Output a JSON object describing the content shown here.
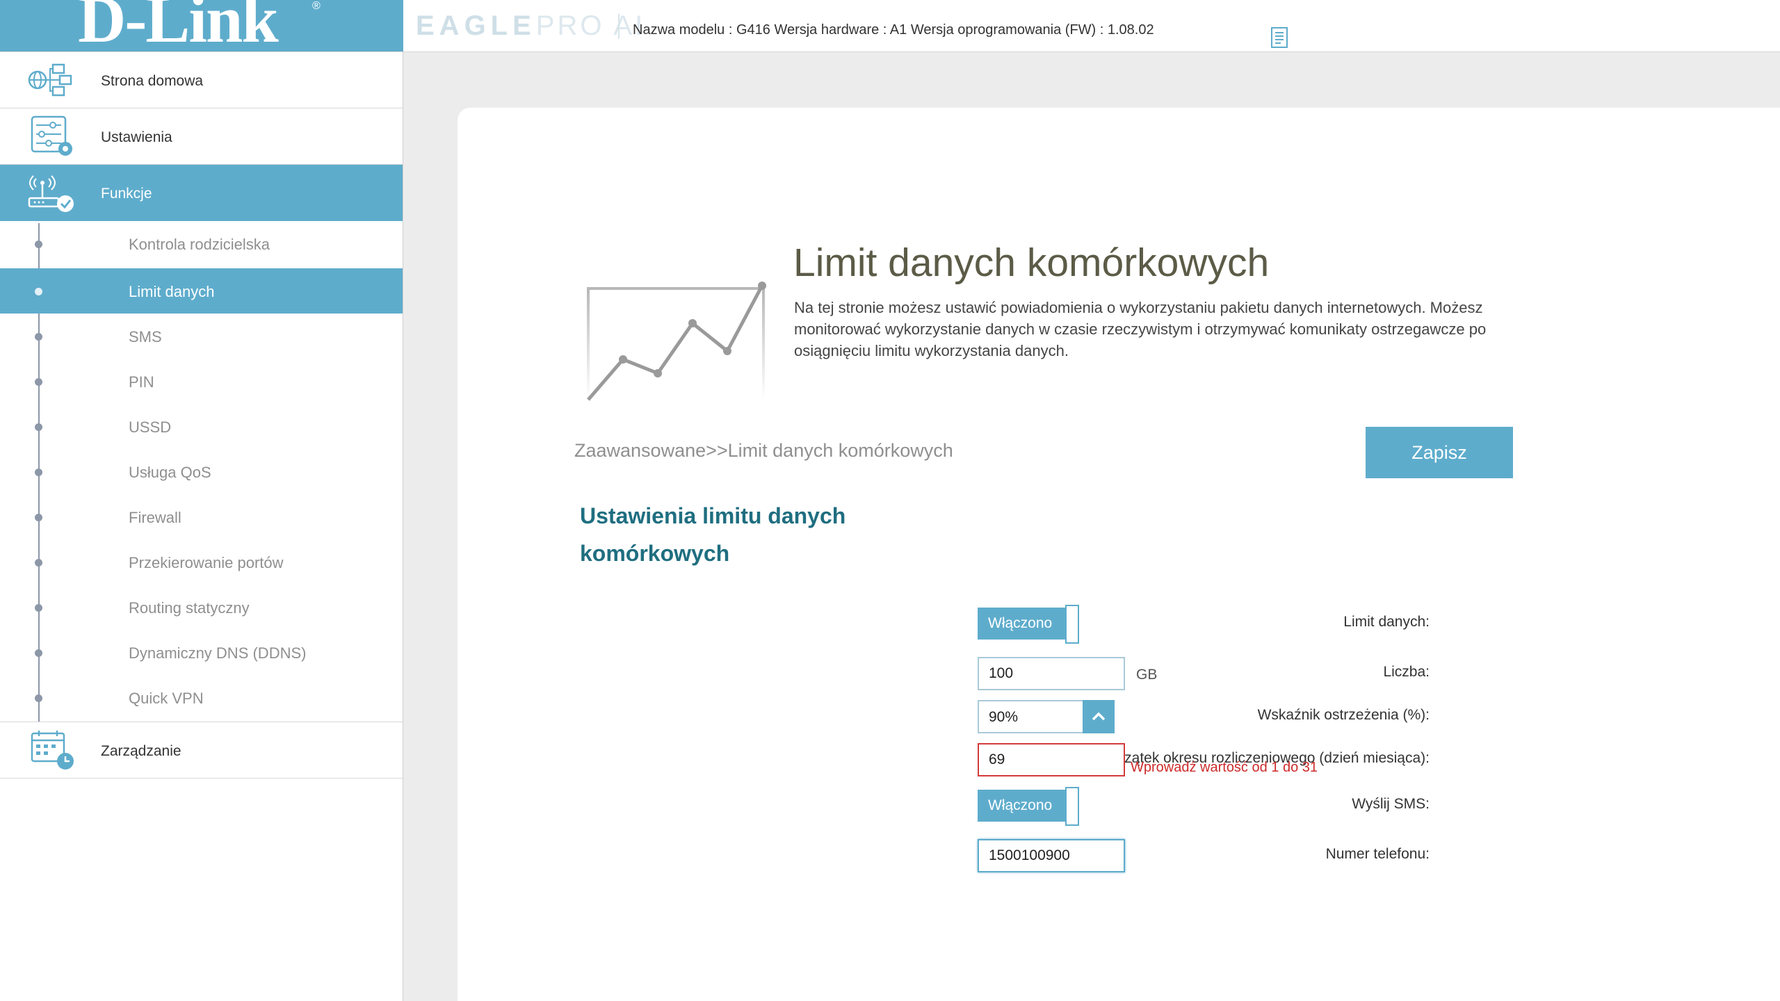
{
  "header": {
    "logo": "D-Link",
    "logo_mark": "®",
    "eagle_bold": "EAGLE",
    "eagle_light": "PRO AI",
    "device_info": "Nazwa modelu : G416 Wersja hardware : A1 Wersja oprogramowania (FW) : 1.08.02"
  },
  "sidebar": {
    "menu": [
      {
        "label": "Strona domowa",
        "icon": "home-network-icon"
      },
      {
        "label": "Ustawienia",
        "icon": "settings-sliders-icon"
      },
      {
        "label": "Funkcje",
        "icon": "router-features-icon"
      },
      {
        "label": "Zarządzanie",
        "icon": "calendar-clock-icon"
      }
    ],
    "subitems": [
      "Kontrola rodzicielska",
      "Limit danych",
      "SMS",
      "PIN",
      "USSD",
      "Usługa QoS",
      "Firewall",
      "Przekierowanie portów",
      "Routing statyczny",
      "Dynamiczny DNS (DDNS)",
      "Quick VPN"
    ],
    "active_subitem": "Limit danych"
  },
  "main": {
    "title": "Limit danych komórkowych",
    "description": "Na tej stronie możesz ustawić powiadomienia o wykorzystaniu pakietu danych internetowych. Możesz monitorować wykorzystanie danych w czasie rzeczywistym i otrzymywać komunikaty ostrzegawcze po osiągnięciu limitu wykorzystania danych.",
    "breadcrumb": "Zaawansowane>>Limit danych komórkowych",
    "save_label": "Zapisz",
    "section_title": "Ustawienia limitu danych komórkowych",
    "form": {
      "limit_label": "Limit danych:",
      "limit_state": "Włączono",
      "amount_label": "Liczba:",
      "amount_value": "100",
      "amount_unit": "GB",
      "warning_label": "Wskaźnik ostrzeżenia (%):",
      "warning_value": "90%",
      "billing_label": "Początek okresu rozliczeniowego (dzień miesiąca):",
      "billing_value": "69",
      "billing_error": "Wprowadź wartość od 1 do 31",
      "sms_label": "Wyślij SMS:",
      "sms_state": "Włączono",
      "phone_label": "Numer telefonu:",
      "phone_value": "1500100900"
    }
  },
  "colors": {
    "accent": "#5eaccc",
    "section_title": "#1f6e80",
    "error": "#cc2b2b"
  }
}
